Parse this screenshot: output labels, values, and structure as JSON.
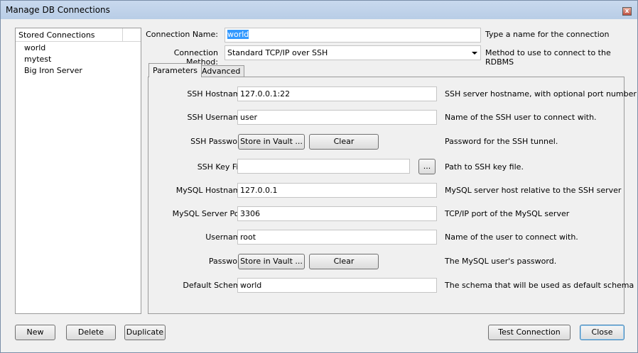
{
  "window": {
    "title": "Manage DB Connections"
  },
  "sidebar": {
    "header": "Stored Connections",
    "items": [
      {
        "label": "world"
      },
      {
        "label": "mytest"
      },
      {
        "label": "Big Iron Server"
      }
    ]
  },
  "form": {
    "name_label": "Connection Name:",
    "name_value": "world",
    "name_help": "Type a name for the connection",
    "method_label": "Connection Method:",
    "method_value": "Standard TCP/IP over SSH",
    "method_help": "Method to use to connect to the RDBMS"
  },
  "tabs": [
    {
      "label": "Parameters",
      "active": true
    },
    {
      "label": "Advanced",
      "active": false
    }
  ],
  "params": {
    "ssh_host": {
      "label": "SSH Hostname:",
      "value": "127.0.0.1:22",
      "help": "SSH server hostname, with optional port number"
    },
    "ssh_user": {
      "label": "SSH Username:",
      "value": "user",
      "help": "Name of the SSH user to connect with."
    },
    "ssh_pass": {
      "label": "SSH Password:",
      "store": "Store in Vault ...",
      "clear": "Clear",
      "help": "Password for the SSH tunnel."
    },
    "ssh_key": {
      "label": "SSH Key File:",
      "value": "",
      "browse": "...",
      "help": "Path to SSH key file."
    },
    "mysql_host": {
      "label": "MySQL Hostname:",
      "value": "127.0.0.1",
      "help": "MySQL server host relative to the SSH server"
    },
    "mysql_port": {
      "label": "MySQL Server Port:",
      "value": "3306",
      "help": "TCP/IP port of the MySQL server"
    },
    "username": {
      "label": "Username:",
      "value": "root",
      "help": "Name of the user to connect with."
    },
    "password": {
      "label": "Password:",
      "store": "Store in Vault ...",
      "clear": "Clear",
      "help": "The MySQL user's password."
    },
    "schema": {
      "label": "Default Schema:",
      "value": "world",
      "help": "The schema that will be used as default schema"
    }
  },
  "buttons": {
    "new": "New",
    "delete": "Delete",
    "duplicate": "Duplicate",
    "test": "Test Connection",
    "close": "Close"
  }
}
